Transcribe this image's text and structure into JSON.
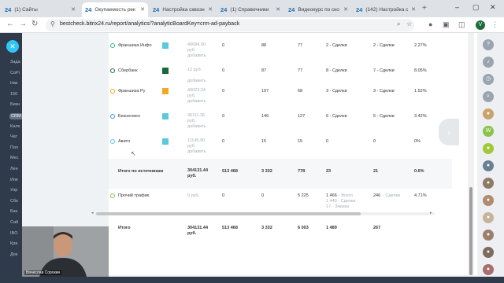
{
  "browser": {
    "tabs": [
      {
        "label": "(1) Сайты",
        "active": false
      },
      {
        "label": "Окупаемость рек",
        "active": true
      },
      {
        "label": "Настройка сквозн",
        "active": false
      },
      {
        "label": "(1) Справочники",
        "active": false
      },
      {
        "label": "Видеокурс по ско",
        "active": false
      },
      {
        "label": "(142) Настройка с",
        "active": false
      }
    ],
    "tab_prefix": "24",
    "url": "bestcheck.bitrix24.ru/report/analytics/?analyticBoardKey=crm-ad-payback",
    "profile_letter": "V"
  },
  "sidebar": {
    "items": [
      "Зада",
      "CoPi",
      "Нак",
      "150",
      "Бизн",
      "CRM",
      "Кале",
      "Чат",
      "Пол",
      "Мес",
      "Лен",
      "Ипе",
      "Упр",
      "Сбе",
      "Баз",
      "Сай",
      "IBO",
      "Кра",
      "Док"
    ]
  },
  "table": {
    "add_label": "добавить",
    "rows": [
      {
        "name": "Франшиза Инфо",
        "color": "#5bc8dc",
        "cost": "40684.50",
        "cur": "руб.",
        "c1": "0",
        "c2": "88",
        "c3": "77",
        "deals": "2 - Сделки",
        "won": "2 - Сделки",
        "pct": "2.27%",
        "dot": "#2fb87a",
        "add": true
      },
      {
        "name": "Сбербанк",
        "color": "#146b3a",
        "cost": "12 руб.",
        "cur": "",
        "c1": "0",
        "c2": "87",
        "c3": "77",
        "deals": "8 - Сделки",
        "won": "7 - Сделки",
        "pct": "8.05%",
        "dot": "#146b3a",
        "add": true
      },
      {
        "name": "Франшиза Ру",
        "color": "#f5a623",
        "cost": "49023.24",
        "cur": "руб.",
        "c1": "0",
        "c2": "197",
        "c3": "68",
        "deals": "3 - Сделки",
        "won": "3 - Сделки",
        "pct": "1.52%",
        "dot": "#f5a623",
        "add": true
      },
      {
        "name": "Бизнесмен",
        "color": "#5bc8dc",
        "cost": "35111.36",
        "cur": "руб.",
        "c1": "0",
        "c2": "146",
        "c3": "127",
        "deals": "6 - Сделки",
        "won": "5 - Сделки",
        "pct": "3.42%",
        "dot": "#2f9fe0",
        "add": true
      },
      {
        "name": "Авито",
        "color": "#5bc8dc",
        "cost": "11145.90",
        "cur": "руб.",
        "c1": "0",
        "c2": "15",
        "c3": "15",
        "deals": "0",
        "won": "0",
        "pct": "0%",
        "dot": "#5bc8dc",
        "add": true
      }
    ],
    "total_sources": {
      "name": "Итого по источникам",
      "cost": "304131.44",
      "cur": "руб.",
      "c1": "513 468",
      "c2": "3 332",
      "c3": "778",
      "deals": "23",
      "won": "21",
      "pct": "0.6%"
    },
    "other": {
      "name": "Прочий трафик",
      "cost": "0 руб.",
      "c1": "0",
      "c2": "0",
      "c3": "5 225",
      "deals": "1 466",
      "deals2": "- Всего",
      "deals3": "1 449 - Сделки",
      "deals4": "17 - Заказы",
      "won": "246",
      "won2": "- Сделки",
      "pct": "4.71%"
    },
    "total": {
      "name": "Итого",
      "cost": "304131.44",
      "cur": "руб.",
      "c1": "513 468",
      "c2": "3 332",
      "c3": "6 003",
      "deals": "1 489",
      "won": "267"
    }
  },
  "webcam": {
    "name": "Вячеслав Сорокин"
  }
}
